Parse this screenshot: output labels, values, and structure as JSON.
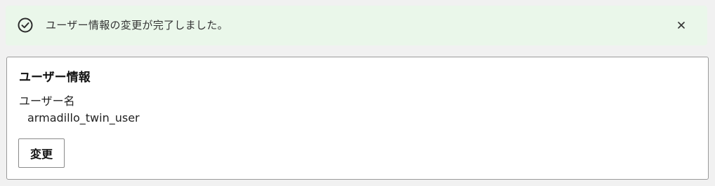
{
  "alert": {
    "message": "ユーザー情報の変更が完了しました。",
    "status_icon": "check-circle-icon",
    "close_icon": "close-icon",
    "background_color": "#eaf7ea",
    "icon_color": "#2b2b2b"
  },
  "user_info": {
    "title": "ユーザー情報",
    "username_label": "ユーザー名",
    "username_value": "armadillo_twin_user",
    "change_button_label": "変更"
  }
}
